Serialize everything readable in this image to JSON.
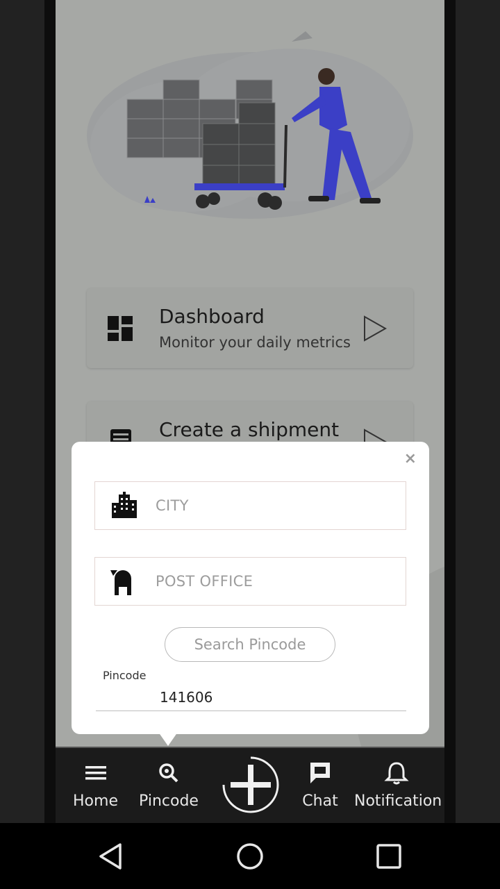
{
  "cards": [
    {
      "title": "Dashboard",
      "subtitle": "Monitor your daily metrics",
      "icon": "dashboard-icon"
    },
    {
      "title": "Create a shipment",
      "subtitle": "",
      "icon": "shipment-icon"
    }
  ],
  "popup": {
    "close_label": "×",
    "city_placeholder": "CITY",
    "post_office_placeholder": "POST OFFICE",
    "search_button": "Search Pincode",
    "pincode_label": "Pincode",
    "pincode_value": "141606"
  },
  "nav": {
    "home": "Home",
    "pincode": "Pincode",
    "chat": "Chat",
    "notification": "Notification"
  },
  "colors": {
    "accent": "#3b3fc6",
    "scrim": "#a6a8a5",
    "navbar": "#1b1b1b"
  }
}
